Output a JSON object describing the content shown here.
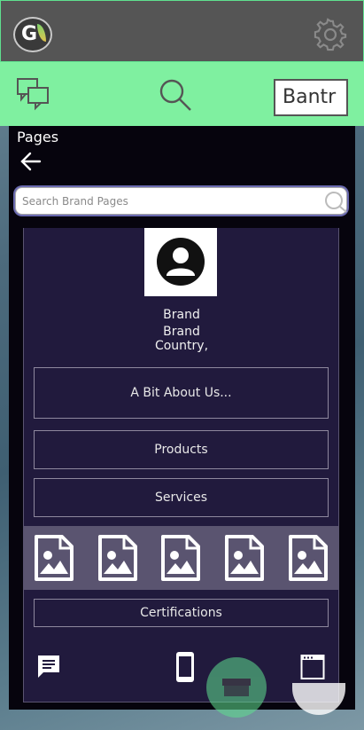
{
  "header": {
    "logo_letter": "G",
    "settings_icon": "gear-icon"
  },
  "navbar": {
    "chat_icon": "chat-bubbles-icon",
    "search_icon": "search-icon",
    "bantr_label": "Bantr"
  },
  "page": {
    "title": "Pages",
    "back_icon": "arrow-left-icon",
    "search_placeholder": "Search Brand Pages"
  },
  "profile": {
    "name": "Brand",
    "brand_line": "Brand",
    "country_line": "Country,"
  },
  "sections": {
    "about": "A Bit About Us...",
    "products": "Products",
    "services": "Services",
    "certifications": "Certifications"
  },
  "gallery": {
    "image_count": 5,
    "icon": "image-file-icon"
  },
  "bottom_bar": {
    "left_icon": "message-icon",
    "center_icon": "mobile-phone-icon",
    "right_icon": "browser-window-icon"
  },
  "colors": {
    "accent_green": "#7ff0a0",
    "card_bg": "#211a3d",
    "panel_bg": "#06040d",
    "topbar_bg": "#555555"
  }
}
